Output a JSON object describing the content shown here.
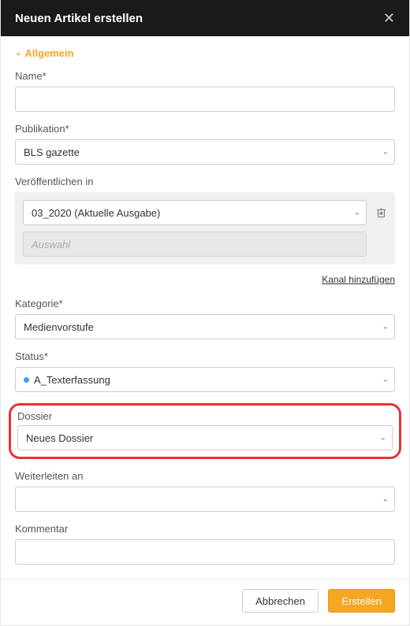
{
  "header": {
    "title": "Neuen Artikel erstellen"
  },
  "section": {
    "general": "Allgemein"
  },
  "fields": {
    "name_label": "Name*",
    "name_value": "",
    "publication_label": "Publikation*",
    "publication_value": "BLS gazette",
    "publish_in_label": "Veröffentlichen in",
    "issue_selected": "03_2020 (Aktuelle Ausgabe)",
    "channel_placeholder": "Auswahl",
    "add_channel": "Kanal hinzufügen",
    "category_label": "Kategorie*",
    "category_value": "Medienvorstufe",
    "status_label": "Status*",
    "status_value": "A_Texterfassung",
    "dossier_label": "Dossier",
    "dossier_value": "Neues Dossier",
    "forward_label": "Weiterleiten an",
    "forward_value": "",
    "comment_label": "Kommentar",
    "comment_value": ""
  },
  "footer": {
    "cancel": "Abbrechen",
    "create": "Erstellen"
  }
}
